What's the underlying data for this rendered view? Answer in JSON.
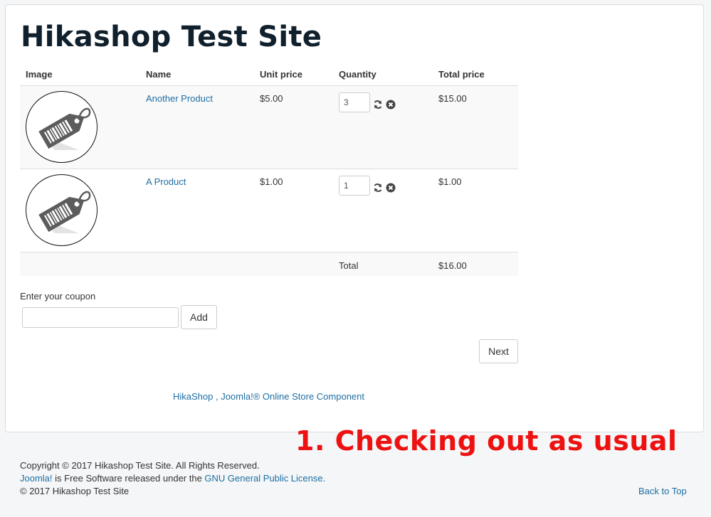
{
  "site": {
    "title": "Hikashop Test Site"
  },
  "cart": {
    "headers": [
      "Image",
      "Name",
      "Unit price",
      "Quantity",
      "Total price"
    ],
    "items": [
      {
        "image_icon": "price-tag-image",
        "name": "Another Product",
        "unit_price": "$5.00",
        "quantity": "3",
        "total_price": "$15.00"
      },
      {
        "image_icon": "price-tag-image",
        "name": "A Product",
        "unit_price": "$1.00",
        "quantity": "1",
        "total_price": "$1.00"
      }
    ],
    "total_label": "Total",
    "total_value": "$16.00"
  },
  "coupon": {
    "label": "Enter your coupon",
    "value": "",
    "add_label": "Add"
  },
  "checkout": {
    "next_label": "Next"
  },
  "credit": {
    "text": "HikaShop , Joomla!® Online Store Component"
  },
  "annotation": {
    "text": "1. Checking out as usual",
    "color": "#ee1111"
  },
  "footer": {
    "copyright": "Copyright © 2017 Hikashop Test Site. All Rights Reserved.",
    "joomla_link": "Joomla!",
    "free_software_text": " is Free Software released under the ",
    "license_link": "GNU General Public License.",
    "site_copyright": "© 2017 Hikashop Test Site",
    "back_to_top": "Back to Top"
  },
  "colors": {
    "link": "#1f6ea3",
    "background": "#f4f6f7",
    "title": "#10202c"
  }
}
